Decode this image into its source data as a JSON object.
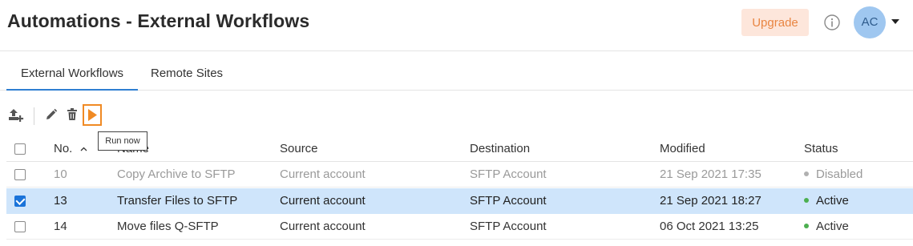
{
  "header": {
    "title": "Automations - External Workflows",
    "upgrade_label": "Upgrade",
    "avatar_initials": "AC",
    "info_icon": "info-icon",
    "account_menu_icon": "caret-down-icon"
  },
  "tabs": [
    {
      "label": "External Workflows",
      "active": true
    },
    {
      "label": "Remote Sites",
      "active": false
    }
  ],
  "toolbar": {
    "icons": [
      "upload-add-icon",
      "edit-icon",
      "delete-icon",
      "run-icon"
    ],
    "tooltip": "Run now"
  },
  "table": {
    "columns": [
      "No.",
      "Name",
      "Source",
      "Destination",
      "Modified",
      "Status"
    ],
    "sort": {
      "column": "No.",
      "direction": "ascending"
    },
    "rows": [
      {
        "no": "10",
        "name": "Copy Archive to SFTP",
        "source": "Current account",
        "destination": "SFTP Account",
        "modified": "21 Sep 2021 17:35",
        "status": "Disabled",
        "checked": false,
        "selected": false
      },
      {
        "no": "13",
        "name": "Transfer Files to SFTP",
        "source": "Current account",
        "destination": "SFTP Account",
        "modified": "21 Sep 2021 18:27",
        "status": "Active",
        "checked": true,
        "selected": true
      },
      {
        "no": "14",
        "name": "Move files Q-SFTP",
        "source": "Current account",
        "destination": "SFTP Account",
        "modified": "06 Oct 2021 13:25",
        "status": "Active",
        "checked": false,
        "selected": false
      }
    ]
  },
  "colors": {
    "accent": "#2f7fd1",
    "selected_row": "#cfe5fb",
    "upgrade_bg": "#fde6db",
    "upgrade_text": "#e98542",
    "run_icon": "#f08a24",
    "status_active": "#4caf50",
    "status_disabled": "#b0b0b0"
  }
}
